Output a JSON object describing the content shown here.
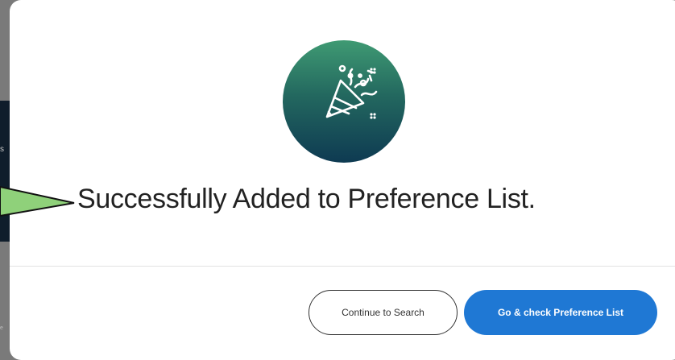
{
  "modal": {
    "message": "Successfully Added to Preference List.",
    "icon": "party-popper-icon",
    "buttons": {
      "continue_label": "Continue to Search",
      "check_label": "Go & check Preference List"
    }
  },
  "background": {
    "fragment_1": "s",
    "fragment_2": "e"
  },
  "colors": {
    "primary": "#1f78d4",
    "badge_top": "#3f9a73",
    "badge_bottom": "#0e3a52",
    "callout": "#8fd17a"
  }
}
